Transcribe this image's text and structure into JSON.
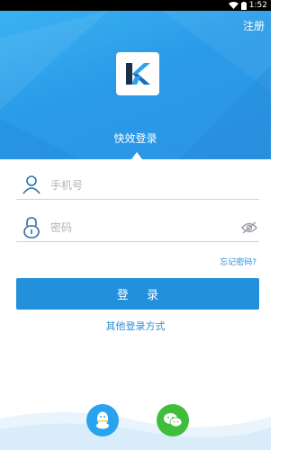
{
  "status_bar": {
    "time": "1:52"
  },
  "header": {
    "register_label": "注册",
    "logo_letter": "K",
    "title": "快效登录"
  },
  "form": {
    "phone_placeholder": "手机号",
    "password_placeholder": "密码",
    "forgot_label": "忘记密码?",
    "login_label": "登 录",
    "other_login_label": "其他登录方式"
  },
  "social": [
    {
      "name": "QQ",
      "icon": "qq-icon",
      "color": "#2aa3ef"
    },
    {
      "name": "WeChat",
      "icon": "wechat-icon",
      "color": "#3fbe3c"
    }
  ],
  "colors": {
    "header_blue": "#2b9be8",
    "accent": "#2390dc",
    "link": "#2a8fd6"
  }
}
